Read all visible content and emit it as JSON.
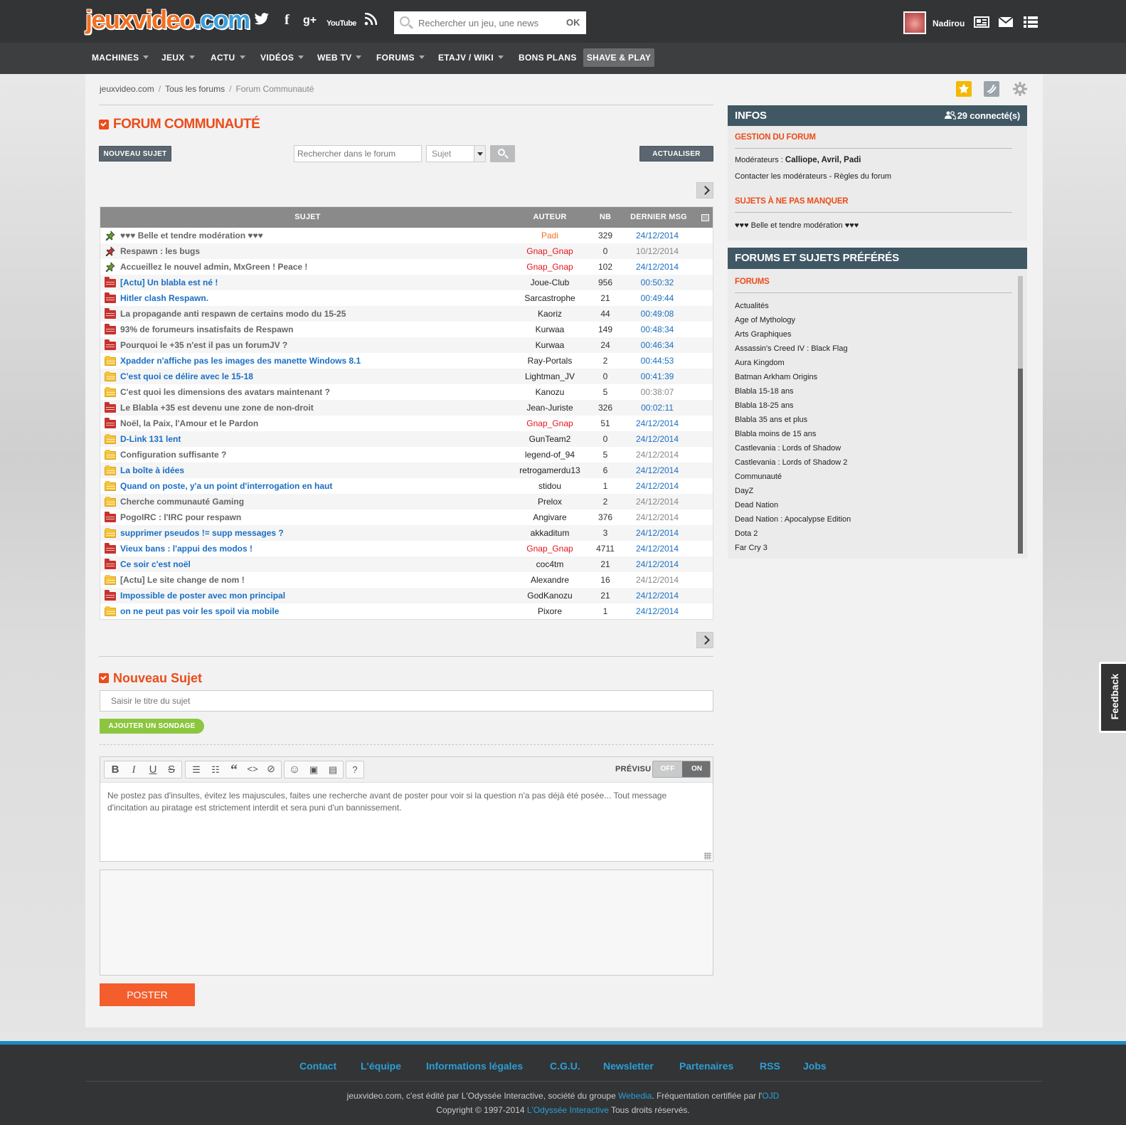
{
  "header": {
    "logo_parts": [
      "jeux",
      "video",
      ".com"
    ],
    "social_icons": [
      "twitter-icon",
      "facebook-icon",
      "google-plus-icon",
      "youtube-icon",
      "rss-icon"
    ],
    "youtube_label": "YouTube",
    "search": {
      "placeholder": "Rechercher un jeu, une news",
      "ok_label": "OK"
    },
    "username": "Nadirou"
  },
  "nav": {
    "items": [
      "MACHINES",
      "JEUX",
      "ACTU",
      "VIDÉOS",
      "WEB TV",
      "FORUMS",
      "ETAJV / WIKI",
      "BONS PLANS",
      "SHAVE & PLAY"
    ]
  },
  "breadcrumb": {
    "items": [
      "jeuxvideo.com",
      "Tous les forums",
      "Forum Communauté"
    ],
    "separator": "/"
  },
  "forum": {
    "title": "FORUM COMMUNAUTÉ",
    "new_topic_label": "NOUVEAU SUJET",
    "search_placeholder": "Rechercher dans le forum",
    "search_scope": "Sujet",
    "refresh_label": "ACTUALISER"
  },
  "table": {
    "headers": {
      "subject": "SUJET",
      "author": "AUTEUR",
      "count": "NB",
      "last": "DERNIER MSG"
    },
    "rows": [
      {
        "icon": "pin-green",
        "subject": "♥♥♥ Belle et tendre modération ♥♥♥",
        "subject_color": "#666",
        "author": "Padi",
        "author_color": "#f36f21",
        "nb": "329",
        "last": "24/12/2014",
        "last_color": "#1a6fc4"
      },
      {
        "icon": "pin-red",
        "subject": "Respawn : les bugs",
        "subject_color": "#666",
        "author": "Gnap_Gnap",
        "author_color": "#e8131c",
        "nb": "0",
        "last": "10/12/2014",
        "last_color": "#888"
      },
      {
        "icon": "pin-green",
        "subject": "Accueillez le nouvel admin, MxGreen ! Peace !",
        "subject_color": "#666",
        "author": "Gnap_Gnap",
        "author_color": "#e8131c",
        "nb": "102",
        "last": "24/12/2014",
        "last_color": "#1a6fc4"
      },
      {
        "icon": "folder-red",
        "subject": "[Actu] Un blabla est né !",
        "subject_color": "#1a6fc4",
        "author": "Joue-Club",
        "author_color": "#222",
        "nb": "956",
        "last": "00:50:32",
        "last_color": "#1a6fc4"
      },
      {
        "icon": "folder-red",
        "subject": "Hitler clash Respawn.",
        "subject_color": "#1a6fc4",
        "author": "Sarcastrophe",
        "author_color": "#222",
        "nb": "21",
        "last": "00:49:44",
        "last_color": "#1a6fc4"
      },
      {
        "icon": "folder-red",
        "subject": "La propagande anti respawn de certains modo du 15-25",
        "subject_color": "#666",
        "author": "Kaoriz",
        "author_color": "#222",
        "nb": "44",
        "last": "00:49:08",
        "last_color": "#1a6fc4"
      },
      {
        "icon": "folder-red",
        "subject": "93% de forumeurs insatisfaits de Respawn",
        "subject_color": "#666",
        "author": "Kurwaa",
        "author_color": "#222",
        "nb": "149",
        "last": "00:48:34",
        "last_color": "#1a6fc4"
      },
      {
        "icon": "folder-red",
        "subject": "Pourquoi le +35 n'est il pas un forumJV ?",
        "subject_color": "#666",
        "author": "Kurwaa",
        "author_color": "#222",
        "nb": "24",
        "last": "00:46:34",
        "last_color": "#1a6fc4"
      },
      {
        "icon": "folder-yellow",
        "subject": "Xpadder n'affiche pas les images des manette Windows 8.1",
        "subject_color": "#1a6fc4",
        "author": "Ray-Portals",
        "author_color": "#222",
        "nb": "2",
        "last": "00:44:53",
        "last_color": "#1a6fc4"
      },
      {
        "icon": "folder-yellow",
        "subject": "C'est quoi ce délire avec le 15-18",
        "subject_color": "#1a6fc4",
        "author": "Lightman_JV",
        "author_color": "#222",
        "nb": "0",
        "last": "00:41:39",
        "last_color": "#1a6fc4"
      },
      {
        "icon": "folder-yellow",
        "subject": "C'est quoi les dimensions des avatars maintenant ?",
        "subject_color": "#666",
        "author": "Kanozu",
        "author_color": "#222",
        "nb": "5",
        "last": "00:38:07",
        "last_color": "#888"
      },
      {
        "icon": "folder-red",
        "subject": "Le Blabla +35 est devenu une zone de non-droit",
        "subject_color": "#666",
        "author": "Jean-Juriste",
        "author_color": "#222",
        "nb": "326",
        "last": "00:02:11",
        "last_color": "#1a6fc4"
      },
      {
        "icon": "folder-red",
        "subject": "Noël, la Paix, l'Amour et le Pardon",
        "subject_color": "#666",
        "author": "Gnap_Gnap",
        "author_color": "#e8131c",
        "nb": "51",
        "last": "24/12/2014",
        "last_color": "#1a6fc4"
      },
      {
        "icon": "folder-yellow",
        "subject": "D-Link 131 lent",
        "subject_color": "#1a6fc4",
        "author": "GunTeam2",
        "author_color": "#222",
        "nb": "0",
        "last": "24/12/2014",
        "last_color": "#1a6fc4"
      },
      {
        "icon": "folder-yellow",
        "subject": "Configuration suffisante ?",
        "subject_color": "#666",
        "author": "legend-of_94",
        "author_color": "#222",
        "nb": "5",
        "last": "24/12/2014",
        "last_color": "#888"
      },
      {
        "icon": "folder-yellow",
        "subject": "La boîte à idées",
        "subject_color": "#1a6fc4",
        "author": "retrogamerdu13",
        "author_color": "#222",
        "nb": "6",
        "last": "24/12/2014",
        "last_color": "#1a6fc4"
      },
      {
        "icon": "folder-yellow",
        "subject": "Quand on poste, y'a un point d'interrogation en haut",
        "subject_color": "#1a6fc4",
        "author": "stidou",
        "author_color": "#222",
        "nb": "1",
        "last": "24/12/2014",
        "last_color": "#1a6fc4"
      },
      {
        "icon": "folder-yellow",
        "subject": "Cherche communauté Gaming",
        "subject_color": "#666",
        "author": "Prelox",
        "author_color": "#222",
        "nb": "2",
        "last": "24/12/2014",
        "last_color": "#888"
      },
      {
        "icon": "folder-red",
        "subject": "PogoIRC : l'IRC pour respawn",
        "subject_color": "#666",
        "author": "Angivare",
        "author_color": "#222",
        "nb": "376",
        "last": "24/12/2014",
        "last_color": "#888"
      },
      {
        "icon": "folder-yellow",
        "subject": "supprimer pseudos != supp messages ?",
        "subject_color": "#1a6fc4",
        "author": "akkaditum",
        "author_color": "#222",
        "nb": "3",
        "last": "24/12/2014",
        "last_color": "#1a6fc4"
      },
      {
        "icon": "folder-red",
        "subject": "Vieux bans : l'appui des modos !",
        "subject_color": "#1a6fc4",
        "author": "Gnap_Gnap",
        "author_color": "#e8131c",
        "nb": "4711",
        "last": "24/12/2014",
        "last_color": "#1a6fc4"
      },
      {
        "icon": "folder-red",
        "subject": "Ce soir c'est noël",
        "subject_color": "#1a6fc4",
        "author": "coc4tm",
        "author_color": "#222",
        "nb": "21",
        "last": "24/12/2014",
        "last_color": "#1a6fc4"
      },
      {
        "icon": "folder-yellow",
        "subject": "[Actu] Le site change de nom !",
        "subject_color": "#666",
        "author": "Alexandre",
        "author_color": "#222",
        "nb": "16",
        "last": "24/12/2014",
        "last_color": "#888"
      },
      {
        "icon": "folder-red",
        "subject": "Impossible de poster avec mon principal",
        "subject_color": "#1a6fc4",
        "author": "GodKanozu",
        "author_color": "#222",
        "nb": "21",
        "last": "24/12/2014",
        "last_color": "#1a6fc4"
      },
      {
        "icon": "folder-yellow",
        "subject": "on ne peut pas voir les spoil via mobile",
        "subject_color": "#1a6fc4",
        "author": "Pixore",
        "author_color": "#222",
        "nb": "1",
        "last": "24/12/2014",
        "last_color": "#1a6fc4"
      }
    ]
  },
  "new_subject": {
    "title": "Nouveau Sujet",
    "title_placeholder": "Saisir le titre du sujet",
    "poll_label": "AJOUTER UN SONDAGE",
    "preview_label": "PRÉVISU",
    "toggle_off": "OFF",
    "toggle_on": "ON",
    "editor_text": "Ne postez pas d'insultes, évitez les majuscules, faites une recherche avant de poster pour voir si la question n'a pas déjà été posée... Tout message d'incitation au piratage est strictement interdit et sera puni d'un bannissement.",
    "post_label": "POSTER",
    "toolbar_icons": [
      "bold-icon",
      "italic-icon",
      "underline-icon",
      "strikethrough-icon",
      "bullet-list-icon",
      "numbered-list-icon",
      "quote-icon",
      "code-icon",
      "spoiler-icon",
      "smiley-icon",
      "image-icon",
      "video-icon",
      "help-icon"
    ]
  },
  "infos": {
    "title": "INFOS",
    "connected": "29 connecté(s)",
    "gestion_title": "GESTION DU FORUM",
    "moderators_label": "Modérateurs : ",
    "moderators": "Calliope, Avril, Padi",
    "contact_text": "Contacter les modérateurs - Règles du forum",
    "must_see_title": "SUJETS À NE PAS MANQUER",
    "must_see_item": "♥♥♥ Belle et tendre modération ♥♥♥"
  },
  "favorites": {
    "title": "FORUMS ET SUJETS PRÉFÉRÉS",
    "forums_title": "FORUMS",
    "items": [
      "Actualités",
      "Age of Mythology",
      "Arts Graphiques",
      "Assassin's Creed IV : Black Flag",
      "Aura Kingdom",
      "Batman Arkham Origins",
      "Blabla 15-18 ans",
      "Blabla 18-25 ans",
      "Blabla 35 ans et plus",
      "Blabla moins de 15 ans",
      "Castlevania : Lords of Shadow",
      "Castlevania : Lords of Shadow 2",
      "Communauté",
      "DayZ",
      "Dead Nation",
      "Dead Nation : Apocalypse Edition",
      "Dota 2",
      "Far Cry 3"
    ]
  },
  "feedback_label": "Feedback",
  "footer": {
    "links": [
      "Contact",
      "L'équipe",
      "Informations légales",
      "C.G.U.",
      "Newsletter",
      "Partenaires",
      "RSS",
      "Jobs"
    ],
    "line1_a": "jeuxvideo.com, c'est édité par L'Odyssée Interactive, société du groupe ",
    "line1_link1": "Webedia",
    "line1_b": ". Fréquentation certifiée par l'",
    "line1_link2": "OJD",
    "line2_a": "Copyright © 1997-2014 ",
    "line2_link": "L'Odyssée Interactive",
    "line2_b": " Tous droits réservés."
  },
  "colors": {
    "accent": "#ec4c1a",
    "link": "#1a6fc4",
    "panel_header": "#405764",
    "footer_link": "#2a9fd8"
  }
}
